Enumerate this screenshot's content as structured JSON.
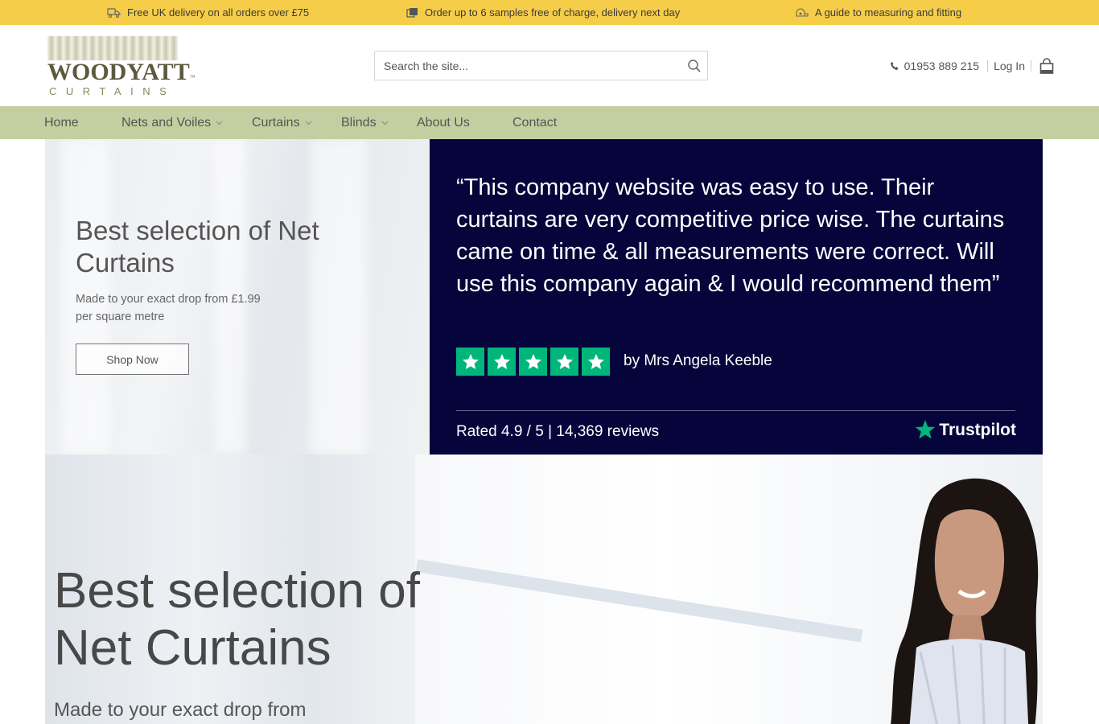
{
  "topbar": {
    "delivery": "Free UK delivery on all orders over £75",
    "samples": "Order up to 6 samples free of charge, delivery next day",
    "guide": "A guide to measuring and fitting"
  },
  "logo": {
    "name": "WOODYATT",
    "sub": "CURTAINS",
    "tm": "™"
  },
  "search": {
    "placeholder": "Search the site..."
  },
  "header": {
    "phone": "01953 889 215",
    "login": "Log In"
  },
  "nav": {
    "items": [
      {
        "label": "Home"
      },
      {
        "label": "Nets and Voiles"
      },
      {
        "label": "Curtains"
      },
      {
        "label": "Blinds"
      },
      {
        "label": "About Us"
      },
      {
        "label": "Contact"
      }
    ]
  },
  "hero_small": {
    "title": "Best selection of Net Curtains",
    "subtitle": "Made to your exact drop from £1.99 per square metre",
    "cta": "Shop Now"
  },
  "review": {
    "quote": "“This company website was easy to use. Their curtains are very competitive price wise. The curtains came on time & all measurements were correct. Will use this company again & I would recommend them”",
    "stars": 5,
    "author": "by Mrs Angela Keeble",
    "rating": "Rated 4.9 / 5 | 14,369 reviews",
    "brand": "Trustpilot"
  },
  "hero_large": {
    "title": "Best selection of Net Curtains",
    "subtitle": "Made to your exact drop from"
  },
  "colors": {
    "topbar": "#f6cd48",
    "nav": "#c4cfa1",
    "review_bg": "#05053b",
    "trustpilot_green": "#00b67a"
  },
  "icons": [
    "truck-icon",
    "swatch-icon",
    "tape-measure-icon",
    "search-icon",
    "phone-icon",
    "basket-icon",
    "chevron-down-icon",
    "star-icon"
  ]
}
